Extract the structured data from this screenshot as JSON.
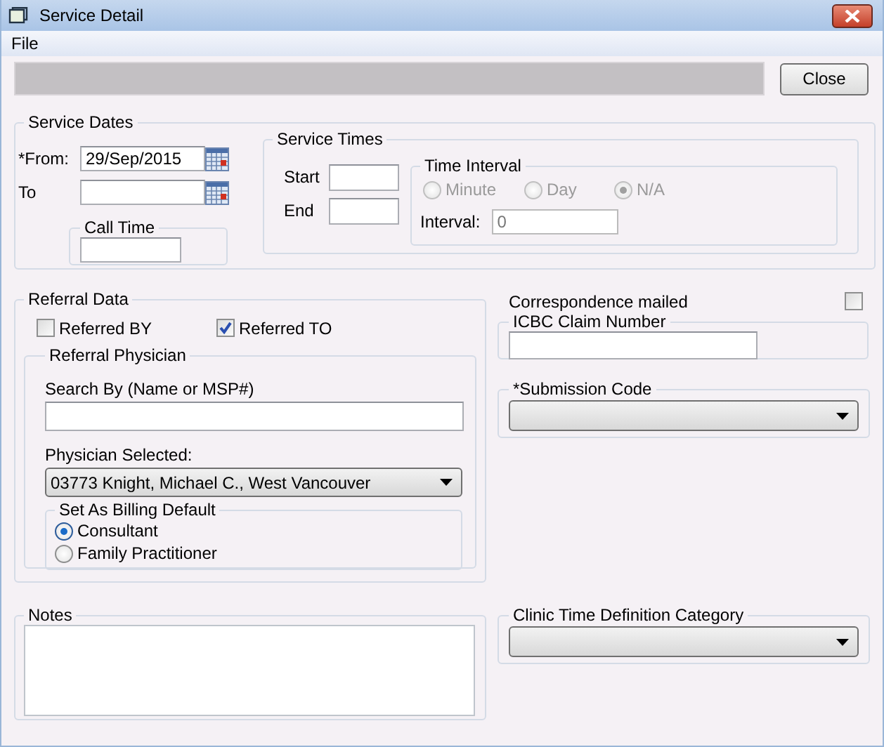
{
  "window": {
    "title": "Service Detail"
  },
  "menu": [
    "File"
  ],
  "close_button": "Close",
  "service_dates": {
    "title": "Service Dates",
    "from": {
      "label": "*From:",
      "value": "29/Sep/2015"
    },
    "to": {
      "label": "To"
    },
    "call_time": {
      "title": "Call Time"
    }
  },
  "service_times": {
    "title": "Service Times",
    "start": {
      "label": "Start"
    },
    "end": {
      "label": "End"
    },
    "time_interval": {
      "title": "Time Interval",
      "disabled": true,
      "options": [
        {
          "label": "Minute",
          "selected": false
        },
        {
          "label": "Day",
          "selected": false
        },
        {
          "label": "N/A",
          "selected": true
        }
      ],
      "interval": {
        "label": "Interval:",
        "value": "0"
      }
    }
  },
  "referral_data": {
    "title": "Referral Data",
    "checks": [
      {
        "label": "Referred BY",
        "checked": false
      },
      {
        "label": "Referred TO",
        "checked": true
      }
    ],
    "physician": {
      "title": "Referral Physician",
      "search_label": "Search By (Name or MSP#)",
      "selected_label": "Physician Selected:",
      "selected_value": "03773 Knight, Michael C., West Vancouver",
      "billing_default": {
        "title": "Set As Billing Default",
        "options": [
          {
            "label": "Consultant",
            "selected": true
          },
          {
            "label": "Family Practitioner",
            "selected": false
          }
        ]
      }
    }
  },
  "correspondence": {
    "label": "Correspondence mailed",
    "checked": false
  },
  "icbc": {
    "title": "ICBC Claim Number"
  },
  "submission": {
    "title": "*Submission Code"
  },
  "notes": {
    "title": "Notes"
  },
  "clinic_time": {
    "title": "Clinic Time Definition Category"
  }
}
